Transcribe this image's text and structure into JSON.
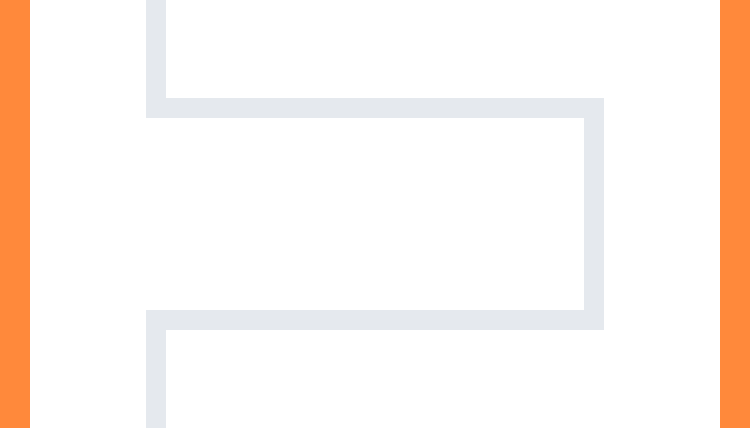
{
  "theme": {
    "accent": "#FF893B",
    "background": "#FFFFFF",
    "pipe_color": "#E5E9EE"
  },
  "decorations": {
    "pipe_shape": "bracket-connector"
  }
}
